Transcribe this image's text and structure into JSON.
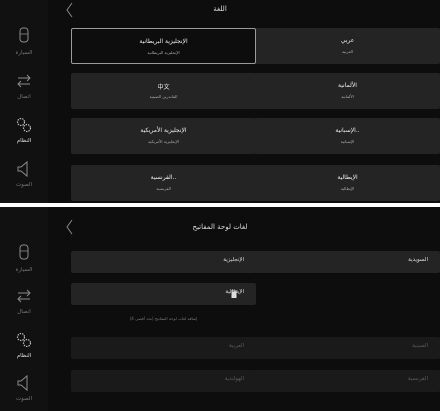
{
  "sidebar": {
    "items": [
      {
        "label": "السيارة",
        "icon": "car-icon"
      },
      {
        "label": "اتصال",
        "icon": "connect-arrows-icon"
      },
      {
        "label": "النظام",
        "icon": "gear-icon"
      },
      {
        "label": "الصوت",
        "icon": "speaker-icon"
      }
    ],
    "active": "النظام"
  },
  "language_screen": {
    "title": "اللغة",
    "back_icon": "chevron-left-icon",
    "languages": [
      {
        "name": "عربي",
        "subtitle": "العربية"
      },
      {
        "name": "الإنجليزية البريطانية",
        "subtitle": "الإنجليزية البريطانية",
        "selected": true
      },
      {
        "name": "الألمانية",
        "subtitle": "الألمانية"
      },
      {
        "name": "中文",
        "subtitle": "الماندرين الصينية"
      },
      {
        "name": "الإسبانية..",
        "subtitle": "الإسبانية"
      },
      {
        "name": "الإنجليزية الأمريكية",
        "subtitle": "الإنجليزية الأمريكية"
      },
      {
        "name": "الإيطالية",
        "subtitle": "الإيطالية"
      },
      {
        "name": "الفرنسية..",
        "subtitle": "الفرنسية"
      }
    ]
  },
  "keyboard_screen": {
    "title": "لغات لوحة المفاتيح",
    "back_icon": "chevron-left-icon",
    "active_rows": [
      {
        "label": "الإنجليزية"
      },
      {
        "label": "السويدية"
      },
      {
        "label": "الإيطالية",
        "icon": "trash-icon"
      }
    ],
    "hint": "إضافة لغات لوحة المفاتيح (بحد أقصى 4)",
    "available_rows": [
      {
        "label": "العربية"
      },
      {
        "label": "الصينية"
      },
      {
        "label": "الهولندية"
      },
      {
        "label": "الفرنسية"
      }
    ]
  },
  "colors": {
    "background": "#0d0d0d",
    "tile": "#242424",
    "selected_border": "#9a9a9a"
  }
}
